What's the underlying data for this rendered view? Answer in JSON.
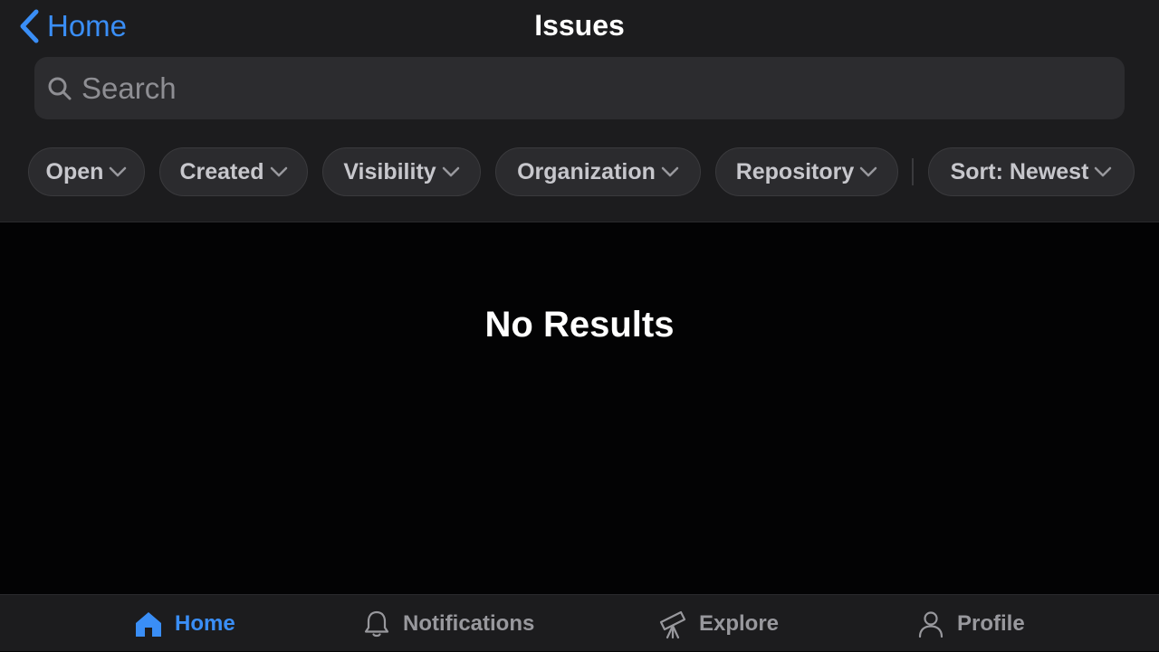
{
  "header": {
    "back_label": "Home",
    "title": "Issues"
  },
  "search": {
    "placeholder": "Search",
    "value": ""
  },
  "filters": {
    "chips": [
      {
        "label": "Open"
      },
      {
        "label": "Created"
      },
      {
        "label": "Visibility"
      },
      {
        "label": "Organization"
      },
      {
        "label": "Repository"
      },
      {
        "label": "Sort: Newest"
      }
    ]
  },
  "main": {
    "empty_title": "No Results"
  },
  "tabbar": {
    "items": [
      {
        "label": "Home",
        "icon": "house-icon",
        "active": true
      },
      {
        "label": "Notifications",
        "icon": "bell-icon",
        "active": false
      },
      {
        "label": "Explore",
        "icon": "telescope-icon",
        "active": false
      },
      {
        "label": "Profile",
        "icon": "person-icon",
        "active": false
      }
    ]
  },
  "colors": {
    "accent": "#3a8ef6",
    "header_bg": "#1c1c1e",
    "content_bg": "#030304",
    "chip_bg": "#2b2b2e",
    "inactive_text": "#98989d"
  }
}
